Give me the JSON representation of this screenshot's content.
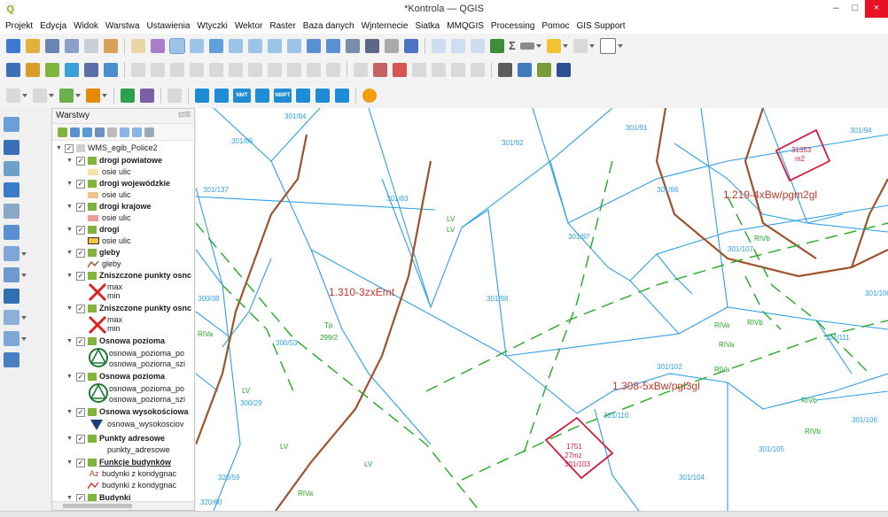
{
  "window": {
    "title": "*Kontrola — QGIS",
    "minimize": "–",
    "maximize": "□",
    "close": "×",
    "app_logo_letter": "Q"
  },
  "menu": [
    "Projekt",
    "Edycja",
    "Widok",
    "Warstwa",
    "Ustawienia",
    "Wtyczki",
    "Wektor",
    "Raster",
    "Baza danych",
    "Wjnternecie",
    "Siatka",
    "MMQGIS",
    "Processing",
    "Pomoc",
    "GIS Support"
  ],
  "toolbar_text": {
    "sigma": "Σ"
  },
  "wms_buttons": {
    "nmt": "NMT",
    "nmpt": "NMPT"
  },
  "layers_panel": {
    "title": "Warstwy",
    "header_buttons": "⊡☒",
    "items": [
      {
        "label": "WMS_egib_Police2",
        "checked": true
      },
      {
        "label": "drogi powiatowe",
        "checked": true
      },
      {
        "label": "osie ulic"
      },
      {
        "label": "drogi wojewódzkie",
        "checked": true
      },
      {
        "label": "osie ulic"
      },
      {
        "label": "drogi krajowe",
        "checked": true
      },
      {
        "label": "osie ulic"
      },
      {
        "label": "drogi",
        "checked": true
      },
      {
        "label": "osie ulic"
      },
      {
        "label": "gleby",
        "checked": true
      },
      {
        "label": "gleby"
      },
      {
        "label": "Zniszczone punkty osnc",
        "checked": true
      },
      {
        "label": "max"
      },
      {
        "label": "min"
      },
      {
        "label": "Zniszczone punkty osnc",
        "checked": true
      },
      {
        "label": "max"
      },
      {
        "label": "min"
      },
      {
        "label": "Osnowa pozioma",
        "checked": true
      },
      {
        "label": "osnowa_pozioma_po"
      },
      {
        "label": "osnowa_pozioma_szi"
      },
      {
        "label": "Osnowa pozioma",
        "checked": true
      },
      {
        "label": "osnowa_pozioma_po"
      },
      {
        "label": "osnowa_pozioma_szi"
      },
      {
        "label": "Osnowa wysokościowa",
        "checked": true
      },
      {
        "label": "osnowa_wysokosciov"
      },
      {
        "label": "Punkty adresowe",
        "checked": true
      },
      {
        "label": "punkty_adresowe"
      },
      {
        "label": "Funkcje budynków",
        "checked": true
      },
      {
        "label": "budynki z kondygnac",
        "prefix": "Az"
      },
      {
        "label": "budynki z kondygnac"
      },
      {
        "label": "Budynki",
        "checked": true
      }
    ]
  },
  "map_labels": {
    "parcels": [
      "301/84",
      "301/85",
      "301/92",
      "301/91",
      "301/94",
      "301/137",
      "301/83",
      "301/86",
      "301/97",
      "301/107",
      "301/98",
      "301/100",
      "300/38",
      "300/53",
      "301/111",
      "301/102",
      "301/110",
      "301/106",
      "301/105",
      "301/104",
      "300/29",
      "320/59",
      "320/60"
    ],
    "landuse": [
      "LV",
      "LV",
      "Tp",
      "299/2",
      "RIVa",
      "LV",
      "RIVa",
      "RIVb",
      "RIVa",
      "RIVa",
      "RIVb",
      "RIVb",
      "LV",
      "RIVa",
      "LV",
      "RIVb"
    ],
    "soil": [
      "1.219-4xBw/pgm2gl",
      "1.310-3zxEmt",
      "1.308-5xBw/pgl3gl"
    ],
    "buildings": [
      "31353",
      "m2",
      "1751",
      "27mz",
      "301/103"
    ]
  },
  "colors": {
    "parcel": "#2ea0e6",
    "soil_line": "#a0522d",
    "landuse": "#22aa22",
    "building": "#d81b3a",
    "soil_label": "#c0392b"
  },
  "icons": {
    "toolbar1": [
      "new-project-icon",
      "open-project-icon",
      "save-project-icon",
      "save-as-icon",
      "new-print-layout-icon",
      "style-manager-icon",
      "pan-icon",
      "pan-to-selection-icon",
      "zoom-in-icon",
      "zoom-out-icon",
      "zoom-full-icon",
      "zoom-to-selection-icon",
      "zoom-to-layer-icon",
      "zoom-last-icon",
      "zoom-next-icon",
      "new-bookmark-icon",
      "show-bookmarks-icon",
      "refresh-icon",
      "temporal-icon",
      "reload-icon",
      "identify-icon",
      "attribute-table-icon",
      "field-calculator-icon",
      "statistics-icon",
      "measure-icon",
      "annotation-icon",
      "select-icon",
      "text-annotation-icon"
    ],
    "toolbar2": [
      "data-source-manager-icon",
      "new-shapefile-icon",
      "add-vector-icon",
      "add-raster-icon",
      "add-database-icon",
      "add-wms-icon",
      "digitize-icon",
      "edit-pencil-icon",
      "save-edits-icon",
      "add-feature-icon",
      "vertex-tool-icon",
      "delete-selected-icon",
      "cut-features-icon",
      "copy-features-icon",
      "paste-features-icon",
      "undo-icon",
      "redo-icon",
      "label-tool-icon",
      "pin-labels-icon",
      "show-hide-labels-icon",
      "move-label-icon",
      "rotate-label-icon",
      "change-label-icon",
      "diagram-icon",
      "plugin-icon",
      "python-console-icon",
      "help-icon"
    ],
    "toolbar3": [
      "digitizing-tools-icon",
      "advanced-digitizing-icon",
      "snapping-icon",
      "shape-digitizing-icon",
      "processing-toolbox-icon",
      "georeferencer-icon",
      "wms-grid-icon",
      "wms-target-icon",
      "nmt-icon",
      "nmpt-icon",
      "wms-layers-icon",
      "wms-squares-icon",
      "wms-circle-icon",
      "wms-number-icon",
      "warning-icon"
    ],
    "left": [
      "add-vector-layer-icon",
      "add-raster-layer-icon",
      "add-mesh-layer-icon",
      "add-postgis-layer-icon",
      "add-delimited-text-icon",
      "add-spatialite-layer-icon",
      "add-wms-layer-icon",
      "add-wcs-layer-icon",
      "add-wfs-layer-icon",
      "add-virtual-layer-icon",
      "new-geopackage-icon",
      "new-temporary-layer-icon"
    ]
  }
}
